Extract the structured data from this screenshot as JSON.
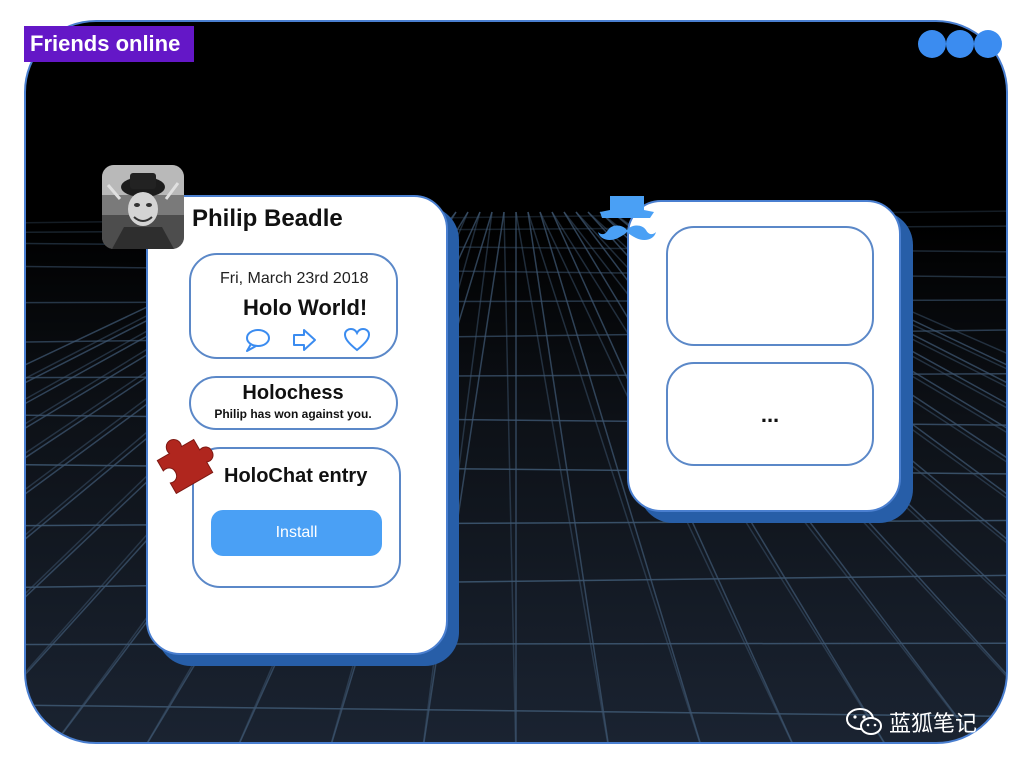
{
  "header": {
    "title": "Friends online",
    "menu_icon": "more-dots-icon"
  },
  "friend_card": {
    "name": "Philip Beadle",
    "avatar_icon": "profile-photo",
    "post": {
      "date": "Fri, March 23rd 2018",
      "title": "Holo World!",
      "actions": [
        "comment-icon",
        "share-icon",
        "heart-icon"
      ]
    },
    "game_notice": {
      "title": "Holochess",
      "message": "Philip has won against you."
    },
    "app_entry": {
      "title": "HoloChat entry",
      "badge_icon": "puzzle-piece-icon",
      "install_label": "Install"
    }
  },
  "second_card": {
    "avatar_icon": "hat-mustache-icon",
    "more_label": "..."
  },
  "watermark": {
    "text": "蓝狐笔记",
    "icon": "wechat-icon"
  },
  "colors": {
    "title_badge": "#6417c7",
    "accent_blue": "#3b8cf0",
    "install_button": "#4aa0f5",
    "card_shadow": "#275ea8",
    "puzzle": "#b0261e"
  }
}
